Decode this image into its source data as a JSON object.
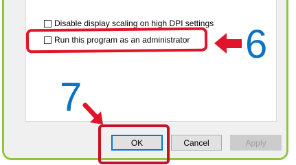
{
  "options": {
    "disable_dpi_label": "Disable display scaling on high DPI settings",
    "run_as_admin_label": "Run this program as an administrator"
  },
  "buttons": {
    "ok": "OK",
    "cancel": "Cancel",
    "apply": "Apply"
  },
  "annotations": {
    "step_6": "6",
    "step_7": "7",
    "highlight_color": "#e0142a",
    "number_color": "#0a73c4"
  },
  "frame_color": "#8cc63e"
}
